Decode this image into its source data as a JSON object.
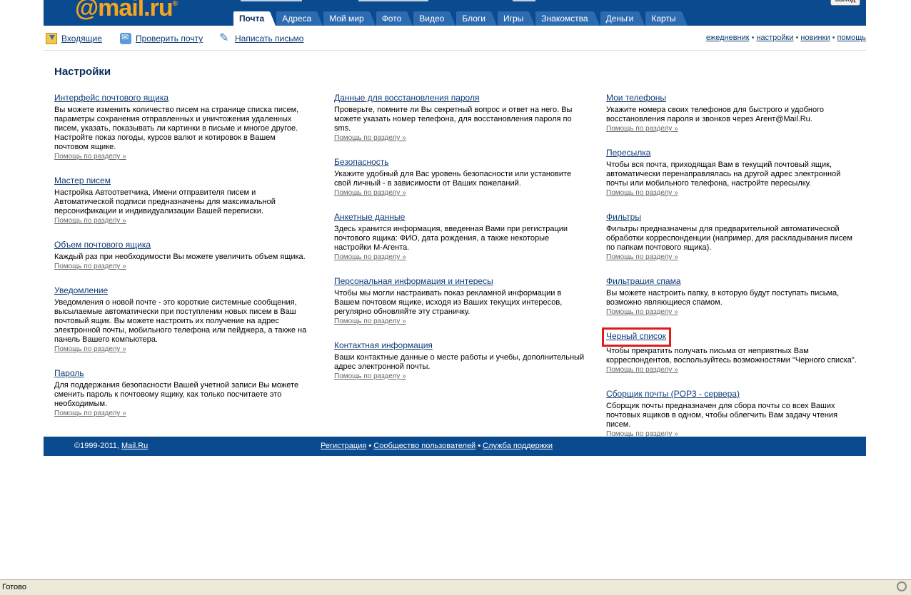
{
  "header": {
    "logo": "@mail.ru",
    "logo_reg": "®",
    "logout_label": "выход",
    "tabs": [
      {
        "label": "Почта",
        "active": true
      },
      {
        "label": "Адреса",
        "active": false
      },
      {
        "label": "Мой мир",
        "active": false
      },
      {
        "label": "Фото",
        "active": false
      },
      {
        "label": "Видео",
        "active": false
      },
      {
        "label": "Блоги",
        "active": false
      },
      {
        "label": "Игры",
        "active": false
      },
      {
        "label": "Знакомства",
        "active": false
      },
      {
        "label": "Деньги",
        "active": false
      },
      {
        "label": "Карты",
        "active": false
      }
    ]
  },
  "toolbar": {
    "inbox_label": "Входящие",
    "check_label": "Проверить почту",
    "write_label": "Написать письмо",
    "right_links": [
      "ежедневник",
      "настройки",
      "новинки",
      "помощь"
    ],
    "separator": "•"
  },
  "page": {
    "title": "Настройки",
    "help_label": "Помощь по разделу »"
  },
  "columns": [
    [
      {
        "title": "Интерфейс почтового ящика",
        "desc": "Вы можете изменить количество писем на странице списка писем, параметры сохранения отправленных и уничтожения удаленных писем, указать, показывать ли картинки в письме и многое другое. Настройте показ погоды, курсов валют и котировок в Вашем почтовом ящике."
      },
      {
        "title": "Мастер писем",
        "desc": "Настройка Автоответчика, Имени отправителя писем и Автоматической подписи предназначены для максимальной персонификации и индивидуализации Вашей переписки."
      },
      {
        "title": "Объем почтового ящика",
        "desc": "Каждый раз при необходимости Вы можете увеличить объем ящика."
      },
      {
        "title": "Уведомление",
        "desc": "Уведомления о новой почте - это короткие системные сообщения, высылаемые автоматически при поступлении новых писем в Ваш почтовый ящик. Вы можете настроить их получение на адрес электронной почты, мобильного телефона или пейджера, а также на панель Вашего компьютера."
      },
      {
        "title": "Пароль",
        "desc": "Для поддержания безопасности Вашей учетной записи Вы можете сменить пароль к почтовому ящику, как только посчитаете это необходимым."
      }
    ],
    [
      {
        "title": "Данные для восстановления пароля",
        "desc": "Проверьте, помните ли Вы секретный вопрос и ответ на него. Вы можете указать номер телефона, для восстановления пароля по sms."
      },
      {
        "title": "Безопасность",
        "desc": "Укажите удобный для Вас уровень безопасности или установите свой личный - в зависимости от Ваших пожеланий."
      },
      {
        "title": "Анкетные данные",
        "desc": "Здесь хранится информация, введенная Вами при регистрации почтового ящика: ФИО, дата рождения, а также некоторые настройки М-Агента."
      },
      {
        "title": "Персональная информация и интересы",
        "desc": "Чтобы мы могли настраивать показ рекламной информации в Вашем почтовом ящике, исходя из Ваших текущих интересов, регулярно обновляйте эту страничку."
      },
      {
        "title": "Контактная информация",
        "desc": "Ваши контактные данные о месте работы и учебы, дополнительный адрес электронной почты."
      }
    ],
    [
      {
        "title": "Мои телефоны",
        "desc": "Укажите номера своих телефонов для быстрого и удобного восстановления пароля и звонков через Агент@Mail.Ru."
      },
      {
        "title": "Пересылка",
        "desc": "Чтобы вся почта, приходящая Вам в текущий почтовый ящик, автоматически перенаправлялась на другой адрес электронной почты или мобильного телефона, настройте пересылку."
      },
      {
        "title": "Фильтры",
        "desc": "Фильтры предназначены для предварительной автоматической обработки корреспонденции (например, для раскладывания писем по папкам почтового ящика)."
      },
      {
        "title": "Фильтрация спама",
        "desc": "Вы можете настроить папку, в которую будут поступать письма, возможно являющиеся спамом."
      },
      {
        "title": "Черный список",
        "desc": "Чтобы прекратить получать письма от неприятных Вам корреспондентов, воспользуйтесь возможностями \"Черного списка\".",
        "highlighted": true
      },
      {
        "title": "Сборщик почты (POP3 - сервера)",
        "desc": "Сборщик почты предназначен для сбора почты со всех Ваших почтовых ящиков в одном, чтобы облегчить Вам задачу чтения писем."
      }
    ]
  ],
  "footer": {
    "copyright_prefix": "©1999-2011,",
    "copyright_link": "Mail.Ru",
    "links": [
      "Регистрация",
      "Сообщество пользователей",
      "Служба поддержки"
    ],
    "separator": "•"
  },
  "statusbar": {
    "text": "Готово"
  },
  "colors": {
    "brand_blue": "#0a4a8f",
    "logo_orange": "#f7a51c",
    "highlight_red": "#e01b1b"
  }
}
